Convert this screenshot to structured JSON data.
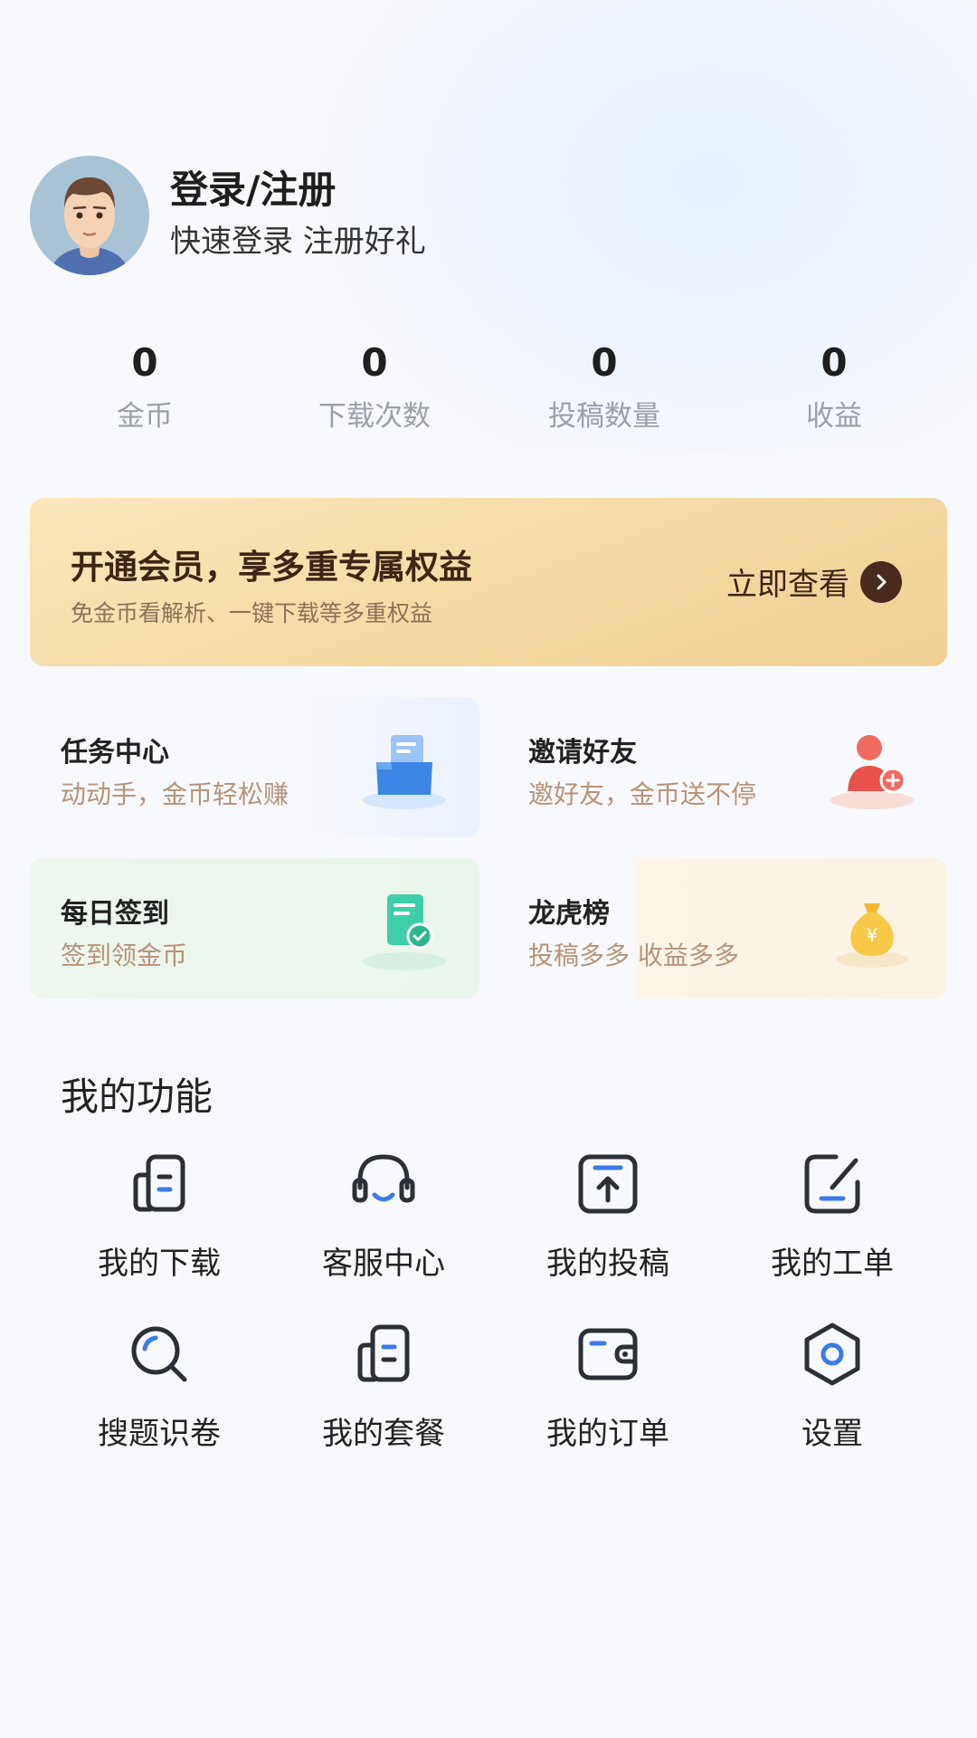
{
  "profile": {
    "title": "登录/注册",
    "subtitle": "快速登录 注册好礼"
  },
  "stats": [
    {
      "value": "0",
      "label": "金币"
    },
    {
      "value": "0",
      "label": "下载次数"
    },
    {
      "value": "0",
      "label": "投稿数量"
    },
    {
      "value": "0",
      "label": "收益"
    }
  ],
  "vip": {
    "title": "开通会员，享多重专属权益",
    "subtitle": "免金币看解析、一键下载等多重权益",
    "button": "立即查看"
  },
  "cards": [
    {
      "title": "任务中心",
      "subtitle": "动动手，金币轻松赚"
    },
    {
      "title": "邀请好友",
      "subtitle": "邀好友，金币送不停"
    },
    {
      "title": "每日签到",
      "subtitle": "签到领金币"
    },
    {
      "title": "龙虎榜",
      "subtitle": "投稿多多 收益多多"
    }
  ],
  "functions": {
    "title": "我的功能",
    "items": [
      {
        "label": "我的下载",
        "icon": "download-doc-icon"
      },
      {
        "label": "客服中心",
        "icon": "headset-icon"
      },
      {
        "label": "我的投稿",
        "icon": "upload-icon"
      },
      {
        "label": "我的工单",
        "icon": "edit-ticket-icon"
      },
      {
        "label": "搜题识卷",
        "icon": "search-icon"
      },
      {
        "label": "我的套餐",
        "icon": "package-icon"
      },
      {
        "label": "我的订单",
        "icon": "wallet-icon"
      },
      {
        "label": "设置",
        "icon": "settings-hexagon-icon"
      }
    ]
  },
  "colors": {
    "accent": "#3A7BEA",
    "icon_stroke": "#2B2F36",
    "vip_text": "#3E2514",
    "card_sub": "#B89379"
  }
}
